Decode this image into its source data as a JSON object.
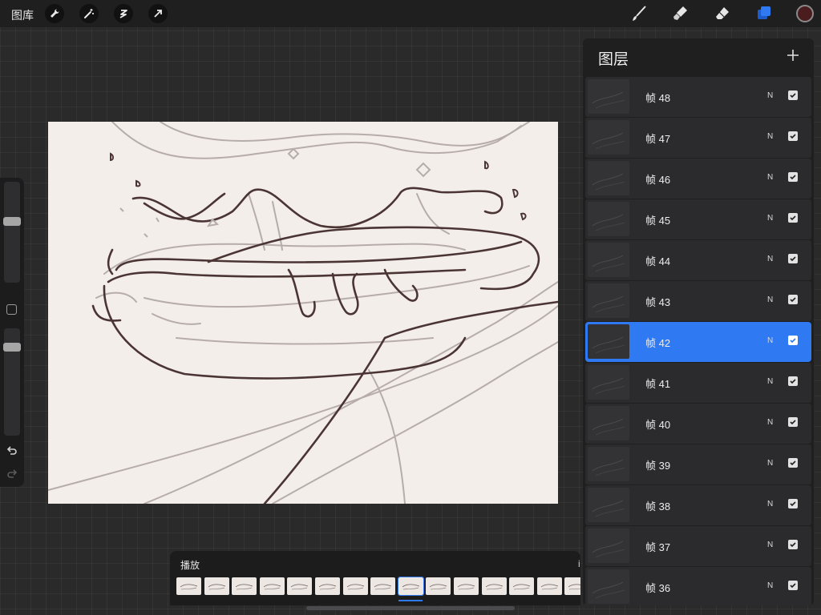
{
  "toolbar": {
    "gallery_label": "图库",
    "left_tools": [
      "wrench-icon",
      "magic-wand-icon",
      "selection-icon",
      "transform-arrow-icon"
    ],
    "right_tools": [
      "brush-icon",
      "smudge-icon",
      "eraser-icon",
      "layers-icon"
    ],
    "current_color": "#4b1c1e",
    "active_color": "#2f79f2"
  },
  "layers_panel": {
    "title": "图层",
    "add_icon": "plus-icon",
    "layers": [
      {
        "name": "帧 48",
        "mode": "N",
        "visible": true,
        "active": false
      },
      {
        "name": "帧 47",
        "mode": "N",
        "visible": true,
        "active": false
      },
      {
        "name": "帧 46",
        "mode": "N",
        "visible": true,
        "active": false
      },
      {
        "name": "帧 45",
        "mode": "N",
        "visible": true,
        "active": false
      },
      {
        "name": "帧 44",
        "mode": "N",
        "visible": true,
        "active": false
      },
      {
        "name": "帧 43",
        "mode": "N",
        "visible": true,
        "active": false
      },
      {
        "name": "帧 42",
        "mode": "N",
        "visible": true,
        "active": true
      },
      {
        "name": "帧 41",
        "mode": "N",
        "visible": true,
        "active": false
      },
      {
        "name": "帧 40",
        "mode": "N",
        "visible": true,
        "active": false
      },
      {
        "name": "帧 39",
        "mode": "N",
        "visible": true,
        "active": false
      },
      {
        "name": "帧 38",
        "mode": "N",
        "visible": true,
        "active": false
      },
      {
        "name": "帧 37",
        "mode": "N",
        "visible": true,
        "active": false
      },
      {
        "name": "帧 36",
        "mode": "N",
        "visible": true,
        "active": false
      }
    ]
  },
  "sidebar": {
    "brush_size": 0.62,
    "brush_opacity": 0.85,
    "modify_icon": "square-icon",
    "undo_icon": "undo-icon",
    "redo_icon": "redo-icon"
  },
  "timeline": {
    "label": "播放",
    "frame_count": 15,
    "current_frame": 9
  }
}
